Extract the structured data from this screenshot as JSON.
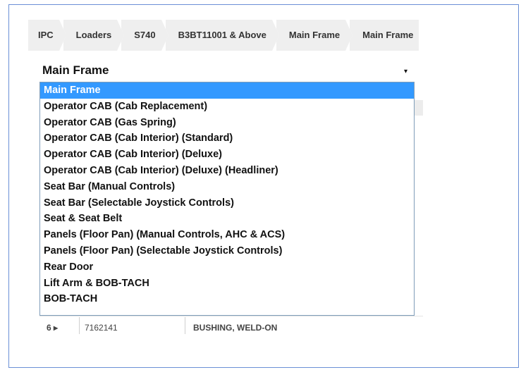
{
  "breadcrumb": {
    "items": [
      {
        "label": "IPC"
      },
      {
        "label": "Loaders"
      },
      {
        "label": "S740"
      },
      {
        "label": "B3BT11001 & Above"
      },
      {
        "label": "Main Frame"
      },
      {
        "label": "Main Frame"
      }
    ]
  },
  "select": {
    "value": "Main Frame",
    "arrow": "▾"
  },
  "dropdown": {
    "options": [
      {
        "label": "Main Frame",
        "selected": true
      },
      {
        "label": "Operator CAB (Cab Replacement)"
      },
      {
        "label": "Operator CAB (Gas Spring)"
      },
      {
        "label": "Operator CAB (Cab Interior) (Standard)"
      },
      {
        "label": "Operator CAB (Cab Interior) (Deluxe)"
      },
      {
        "label": "Operator CAB (Cab Interior) (Deluxe) (Headliner)"
      },
      {
        "label": "Seat Bar (Manual Controls)"
      },
      {
        "label": "Seat Bar (Selectable Joystick Controls)"
      },
      {
        "label": "Seat & Seat Belt"
      },
      {
        "label": "Panels (Floor Pan) (Manual Controls, AHC & ACS)"
      },
      {
        "label": "Panels (Floor Pan) (Selectable Joystick Controls)"
      },
      {
        "label": "Rear Door"
      },
      {
        "label": "Lift Arm & BOB-TACH"
      },
      {
        "label": "BOB-TACH"
      }
    ]
  },
  "table": {
    "partial_row": {
      "ref": "6 ▸",
      "part_number": "7162141",
      "description": "BUSHING, WELD-ON"
    }
  },
  "colors": {
    "selected_bg": "#3399ff",
    "breadcrumb_bg": "#efefef",
    "frame_border": "#6b8fd6"
  }
}
